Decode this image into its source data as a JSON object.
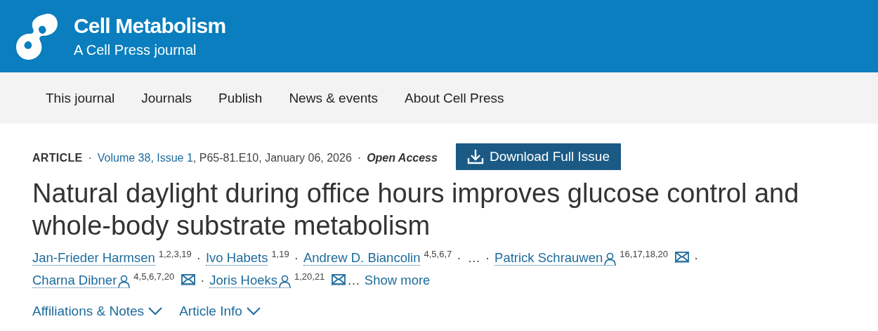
{
  "header": {
    "title": "Cell Metabolism",
    "subtitle": "A Cell Press journal"
  },
  "nav": [
    "This journal",
    "Journals",
    "Publish",
    "News & events",
    "About Cell Press"
  ],
  "meta": {
    "type": "ARTICLE",
    "sep1": "·",
    "volume": "Volume 38, Issue 1",
    "details": ", P65-81.E10, January 06, 2026",
    "sep2": "·",
    "access": "Open Access",
    "download": "Download Full Issue"
  },
  "title": "Natural daylight during office hours improves glucose control and whole-body substrate metabolism",
  "author_lines": [
    [
      {
        "kind": "author",
        "name": "Jan-Frieder Harmsen",
        "sup": "1,2,3,19",
        "corresponding": false,
        "email": false,
        "separator": "·"
      },
      {
        "kind": "author",
        "name": "Ivo Habets",
        "sup": "1,19",
        "corresponding": false,
        "email": false,
        "separator": "·"
      },
      {
        "kind": "author",
        "name": "Andrew D. Biancolin",
        "sup": "4,5,6,7",
        "corresponding": false,
        "email": false,
        "separator": "·"
      },
      {
        "kind": "ellipsis",
        "text": "…",
        "separator": "·"
      },
      {
        "kind": "author",
        "name": "Patrick Schrauwen",
        "sup": "16,17,18,20",
        "corresponding": true,
        "email": true,
        "separator": "·"
      }
    ],
    [
      {
        "kind": "author",
        "name": "Charna Dibner",
        "sup": "4,5,6,7,20",
        "corresponding": true,
        "email": true,
        "separator": "·"
      },
      {
        "kind": "author",
        "name": "Joris Hoeks",
        "sup": "1,20,21",
        "corresponding": true,
        "email": true
      },
      {
        "kind": "ellipsis",
        "text": "…"
      },
      {
        "kind": "more",
        "text": "Show more"
      }
    ]
  ],
  "expanders": [
    "Affiliations & Notes",
    "Article Info"
  ]
}
